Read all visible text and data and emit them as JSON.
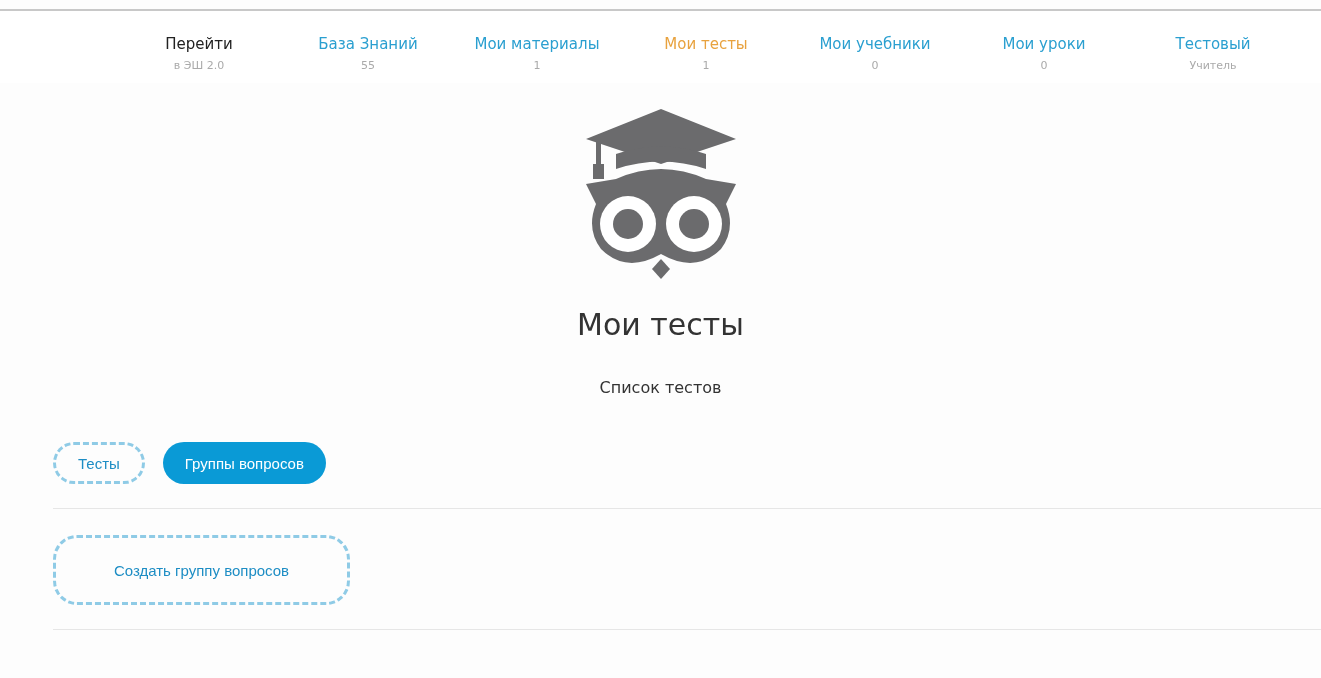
{
  "nav": [
    {
      "label": "Перейти",
      "sub": "в ЭШ 2.0",
      "kind": "external",
      "selected": false
    },
    {
      "label": "База Знаний",
      "sub": "55",
      "kind": "section",
      "selected": false
    },
    {
      "label": "Мои материалы",
      "sub": "1",
      "kind": "section",
      "selected": false
    },
    {
      "label": "Мои тесты",
      "sub": "1",
      "kind": "section",
      "selected": true
    },
    {
      "label": "Мои учебники",
      "sub": "0",
      "kind": "section",
      "selected": false
    },
    {
      "label": "Мои уроки",
      "sub": "0",
      "kind": "section",
      "selected": false
    },
    {
      "label": "Тестовый",
      "sub": "Учитель",
      "kind": "section",
      "selected": false
    }
  ],
  "header": {
    "title": "Мои тесты",
    "subtitle": "Список тестов"
  },
  "tabs": [
    {
      "label": "Тесты",
      "selected": false
    },
    {
      "label": "Группы вопросов",
      "selected": true
    }
  ],
  "create_button": {
    "label": "Создать группу вопросов"
  }
}
